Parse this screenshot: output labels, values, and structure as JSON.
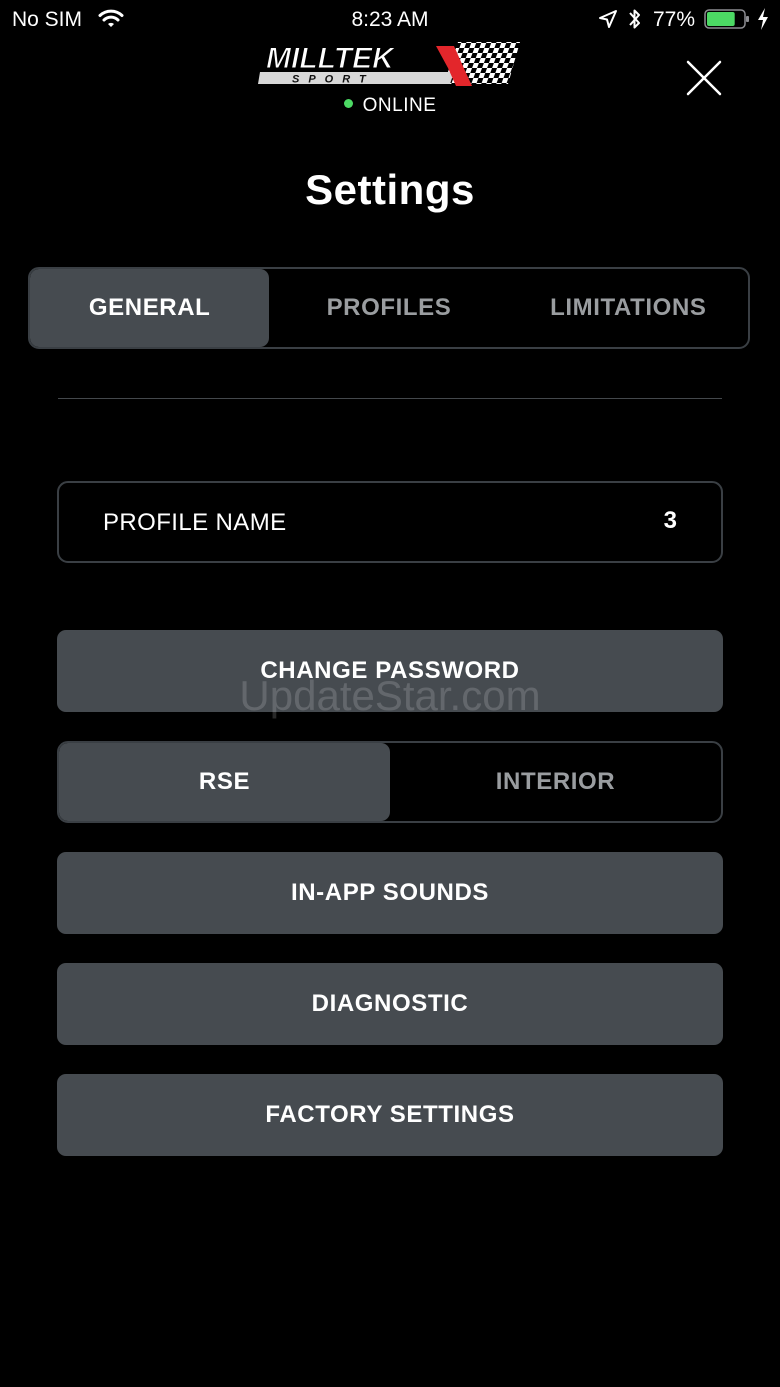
{
  "status_bar": {
    "carrier": "No SIM",
    "time": "8:23 AM",
    "battery_percent": "77%",
    "battery_level": 0.77,
    "icons": [
      "wifi-icon",
      "location-arrow-icon",
      "bluetooth-icon",
      "battery-icon",
      "charging-bolt-icon"
    ]
  },
  "header": {
    "logo_text": "MILLTEK SPORT",
    "connection_status": "ONLINE",
    "status_color": "#4cd964",
    "close_icon": "close-icon"
  },
  "page": {
    "title": "Settings"
  },
  "tabs": [
    {
      "label": "GENERAL",
      "active": true
    },
    {
      "label": "PROFILES",
      "active": false
    },
    {
      "label": "LIMITATIONS",
      "active": false
    }
  ],
  "profile": {
    "label": "PROFILE NAME",
    "value": "3"
  },
  "buttons": {
    "change_password": "CHANGE PASSWORD",
    "in_app_sounds": "IN-APP SOUNDS",
    "diagnostic": "DIAGNOSTIC",
    "factory_settings": "FACTORY SETTINGS"
  },
  "sound_mode": {
    "options": [
      {
        "label": "RSE",
        "active": true
      },
      {
        "label": "INTERIOR",
        "active": false
      }
    ]
  },
  "watermark": "UpdateStar.com",
  "colors": {
    "background": "#000000",
    "button": "#464b50",
    "border": "#3a3f44",
    "inactive_text": "#9a9da0",
    "accent_red": "#e3262b",
    "battery_green": "#4cd964"
  }
}
